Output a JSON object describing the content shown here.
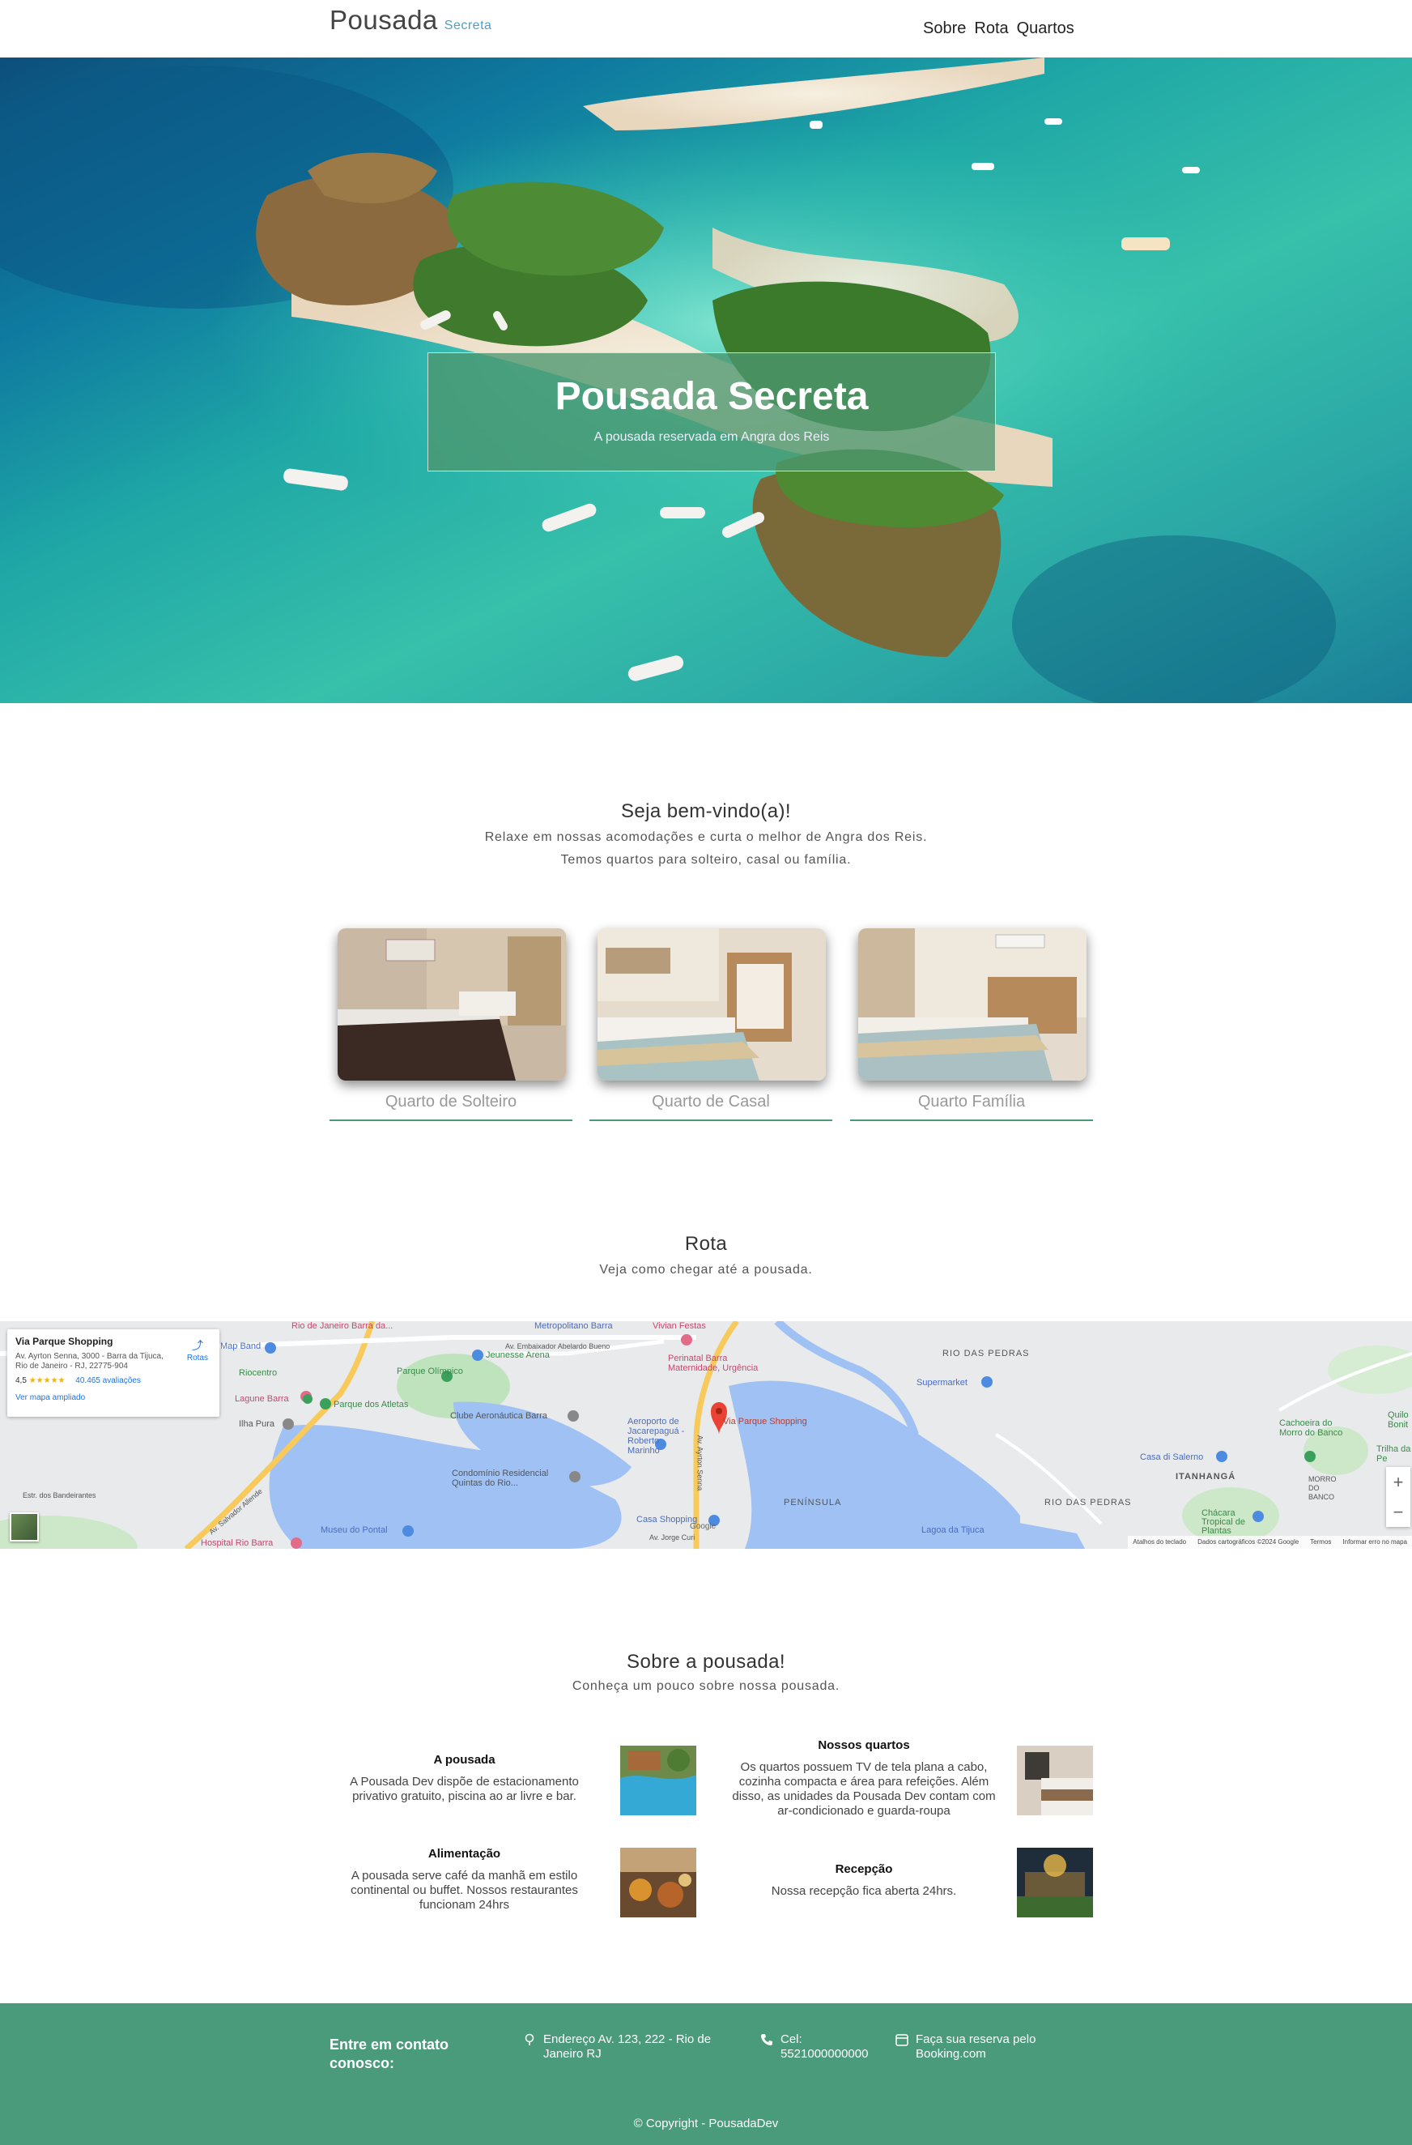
{
  "header": {
    "brand": "Pousada",
    "brand_sub": "Secreta",
    "nav": [
      "Sobre",
      "Rota",
      "Quartos"
    ]
  },
  "hero": {
    "title": "Pousada Secreta",
    "subtitle": "A pousada reservada em Angra dos Reis"
  },
  "welcome": {
    "title": "Seja bem-vindo(a)!",
    "line1": "Relaxe em nossas acomodações e curta o melhor de Angra dos Reis.",
    "line2": "Temos quartos para solteiro, casal ou família."
  },
  "rooms": [
    {
      "label": "Quarto de Solteiro"
    },
    {
      "label": "Quarto de Casal"
    },
    {
      "label": "Quarto Família"
    }
  ],
  "route": {
    "title": "Rota",
    "subtitle": "Veja como chegar até a pousada."
  },
  "map": {
    "place": "Via Parque Shopping",
    "address": "Av. Ayrton Senna, 3000 - Barra da Tijuca, Rio de Janeiro - RJ, 22775-904",
    "rating": "4,5",
    "stars": "★★★★★",
    "reviews": "40.465 avaliações",
    "bigger_map": "Ver mapa ampliado",
    "routes": "Rotas",
    "zoom_in": "+",
    "zoom_out": "−",
    "labels": {
      "metropolitano": "Metropolitano Barra",
      "vivian": "Vivian Festas",
      "rio_barra": "Rio de Janeiro Barra da...",
      "map_band": "Map Band",
      "embaixador": "Av. Embaixador Abelardo Bueno",
      "jeunesse": "Jeunesse Arena",
      "perinatal": "Perinatal Barra\nMaternidade, Urgência",
      "rio_das_pedras_1": "RIO DAS PEDRAS",
      "riocentro": "Riocentro",
      "parque_olimpico": "Parque Olímpico",
      "supermarket": "Supermarket",
      "lagune": "Lagune Barra",
      "parque_atletas": "Parque dos Atletas",
      "clube": "Clube Aeronáutica Barra",
      "ilha_pura": "Ilha Pura",
      "aeroporto": "Aeroporto de Jacarepaguá - Roberto Marinho",
      "via_parque": "Via Parque Shopping",
      "casa_salerno": "Casa di Salerno",
      "cachoeira": "Cachoeira do Morro do Banco",
      "itanhanga": "ITANHANGÁ",
      "trilha": "Trilha da Pe",
      "morro_banco": "MORRO DO BANCO",
      "condominio": "Condomínio Residencial Quintas do Rio...",
      "peninsula": "PENÍNSULA",
      "rio_das_pedras_2": "RIO DAS PEDRAS",
      "chacara": "Chácara Tropical de Plantas",
      "casa_shopping": "Casa Shopping",
      "lagoa": "Lagoa da Tijuca",
      "museu": "Museu do Pontal",
      "hospital": "Hospital Rio Barra",
      "av_salvador": "Av. Salvador Allende",
      "av_ayrton": "Av. Ayrton Senna",
      "quilo": "Quilo Bonit",
      "bandeirantes": "Estr. dos Bandeirantes",
      "av_jorge": "Av. Jorge Curi"
    },
    "footer": [
      "Atalhos do teclado",
      "Dados cartográficos ©2024 Google",
      "Termos",
      "Informar erro no mapa"
    ],
    "google": "Google"
  },
  "about": {
    "title": "Sobre a pousada!",
    "subtitle": "Conheça um pouco sobre nossa pousada.",
    "items": [
      {
        "title": "A pousada",
        "text": "A Pousada Dev dispõe de estacionamento privativo gratuito, piscina ao ar livre e bar."
      },
      {
        "title": "Nossos quartos",
        "text": "Os quartos possuem TV de tela plana a cabo, cozinha compacta e área para refeições. Além disso, as unidades da Pousada Dev contam com ar-condicionado e guarda-roupa"
      },
      {
        "title": "Alimentação",
        "text": "A pousada serve café da manhã em estilo continental ou buffet. Nossos restaurantes funcionam 24hrs"
      },
      {
        "title": "Recepção",
        "text": "Nossa recepção fica aberta 24hrs."
      }
    ]
  },
  "footer": {
    "contact_title": "Entre em contato conosco:",
    "address": "Endereço Av. 123, 222 - Rio de Janeiro RJ",
    "phone": "Cel: 5521000000000",
    "booking": "Faça sua reserva pelo Booking.com",
    "copyright": "© Copyright - PousadaDev"
  },
  "colors": {
    "accent": "#4a9a7c",
    "brand_sub": "#4ca0c8",
    "room_line": "#4a9a7a"
  }
}
